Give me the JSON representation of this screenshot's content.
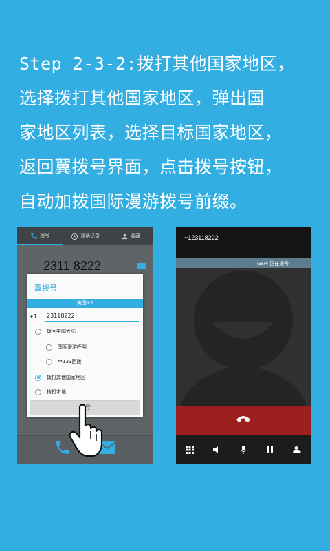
{
  "instruction": {
    "step": "Step 2-3-2:",
    "lines": [
      "拨打其他国家地区，",
      "选择拨打其他国家地区，弹出国",
      "家地区列表，选择目标国家地区，",
      "返回翼拨号界面，点击拨号按钮，",
      "自动加拨国际漫游拨号前缀。"
    ]
  },
  "left_phone": {
    "tabs": [
      {
        "label": "拨号",
        "icon": "phone-icon"
      },
      {
        "label": "通话记录",
        "icon": "clock-icon"
      },
      {
        "label": "收藏",
        "icon": "contact-icon"
      }
    ],
    "dialed_number": "2311 8222",
    "dialog": {
      "title": "翼拨号",
      "country": "美国+1",
      "country_code": "+1",
      "number": "23118222",
      "options": [
        {
          "label": "拨回中国大陆",
          "checked": false
        },
        {
          "label": "国际漫游呼叫",
          "checked": false
        },
        {
          "label": "**133回拨",
          "checked": false
        },
        {
          "label": "拨打其他国家地区",
          "checked": true
        },
        {
          "label": "拨打本地",
          "checked": false
        }
      ],
      "dial_button": "拨号"
    }
  },
  "right_phone": {
    "number": "+123118222",
    "network": "GSM",
    "status": "正在拨号"
  },
  "colors": {
    "background": "#33aee2",
    "accent": "#33aee2",
    "end_call": "#9b1f1d"
  }
}
